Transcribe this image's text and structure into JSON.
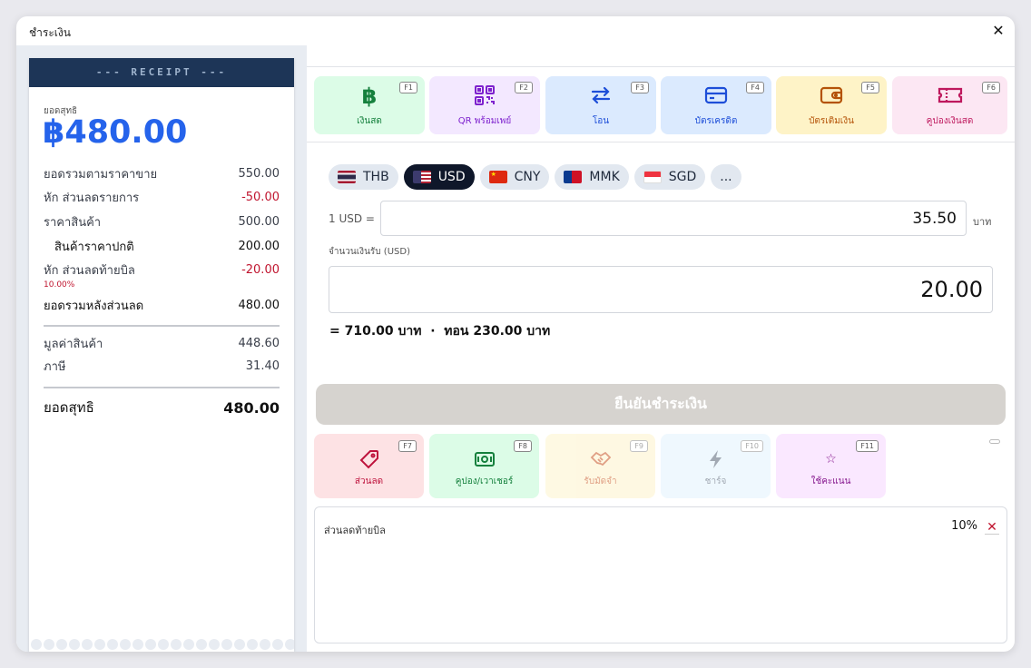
{
  "modal": {
    "title": "ชำระเงิน",
    "close_icon": "✕"
  },
  "receipt": {
    "header": "--- RECEIPT ---",
    "net_label": "ยอดสุทธิ",
    "net_amount": "฿480.00",
    "rows": [
      {
        "label": "ยอดรวมตามราคาขาย",
        "value": "550.00"
      },
      {
        "label": "หัก ส่วนลดรายการ",
        "value": "-50.00"
      },
      {
        "label": "ราคาสินค้า",
        "value": "500.00"
      },
      {
        "label": "สินค้าราคาปกติ",
        "value": "200.00"
      },
      {
        "label": "หัก ส่วนลดท้ายบิล",
        "value": "-20.00"
      },
      {
        "label": "ยอดรวมหลังส่วนลด",
        "value": "480.00"
      },
      {
        "label": "มูลค่าสินค้า",
        "value": "448.60"
      },
      {
        "label": "ภาษี",
        "value": "31.40"
      },
      {
        "label": "ยอดสุทธิ",
        "value": "480.00"
      }
    ],
    "bill_discount_pct": "10.00%"
  },
  "payment_methods": [
    {
      "label": "เงินสด",
      "key": "F1",
      "icon": "baht-icon",
      "bg": "#dcfce7",
      "fg": "#15803d"
    },
    {
      "label": "QR พร้อมเพย์",
      "key": "F2",
      "icon": "qr-code-icon",
      "bg": "#f3e8ff",
      "fg": "#7e22ce"
    },
    {
      "label": "โอน",
      "key": "F3",
      "icon": "transfer-arrows-icon",
      "bg": "#dbeafe",
      "fg": "#1d4ed8"
    },
    {
      "label": "บัตรเครดิต",
      "key": "F4",
      "icon": "credit-card-icon",
      "bg": "#dbeafe",
      "fg": "#1d4ed8"
    },
    {
      "label": "บัตรเติมเงิน",
      "key": "F5",
      "icon": "wallet-icon",
      "bg": "#fef3c7",
      "fg": "#b45309"
    },
    {
      "label": "คูปองเงินสด",
      "key": "F6",
      "icon": "ticket-icon",
      "bg": "#fce7f3",
      "fg": "#be185d"
    }
  ],
  "currencies": [
    {
      "code": "THB",
      "active": false
    },
    {
      "code": "USD",
      "active": true
    },
    {
      "code": "CNY",
      "active": false
    },
    {
      "code": "MMK",
      "active": false
    },
    {
      "code": "SGD",
      "active": false
    },
    {
      "code": "...",
      "active": false
    }
  ],
  "rate": {
    "label": "1 USD =",
    "value": "35.50",
    "unit": "บาท"
  },
  "received": {
    "label": "จำนวนเงินรับ (USD)",
    "value": "20.00"
  },
  "calc_line": "= 710.00 บาท  ·  ทอน 230.00 บาท",
  "confirm_button": "ยืนยันชำระเงิน",
  "actions": [
    {
      "label": "ส่วนลด",
      "key": "F7",
      "icon": "tag-icon",
      "bg": "#fde2e4",
      "fg": "#be123c",
      "enabled": true
    },
    {
      "label": "คูปอง/เวาเชอร์",
      "key": "F8",
      "icon": "voucher-icon",
      "bg": "#dcfce7",
      "fg": "#15803d",
      "enabled": true
    },
    {
      "label": "รับมัดจำ",
      "key": "F9",
      "icon": "handshake-icon",
      "bg": "#fef3c7",
      "fg": "#c2410c",
      "enabled": false
    },
    {
      "label": "ชาร์จ",
      "key": "F10",
      "icon": "lightning-icon",
      "bg": "#e0f2fe",
      "fg": "#475569",
      "enabled": false
    },
    {
      "label": "ใช้คะแนน",
      "key": "F11",
      "icon": "star-icon",
      "bg": "#fae8ff",
      "fg": "#86198f",
      "enabled": true
    }
  ],
  "discount_panel": {
    "label": "ส่วนลดท้ายบิล",
    "value": "10%",
    "remove_icon": "✕"
  }
}
